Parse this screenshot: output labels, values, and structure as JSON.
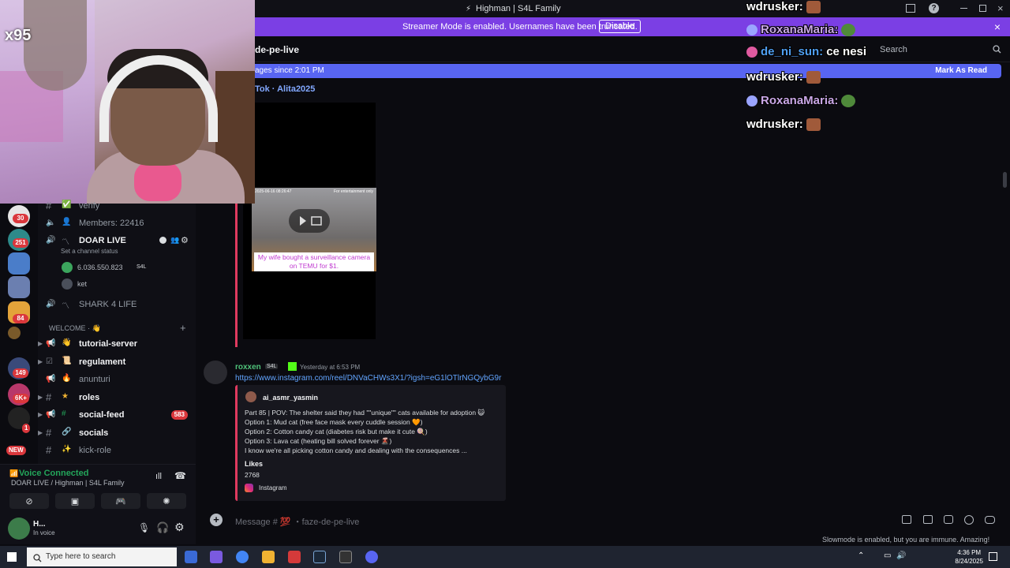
{
  "window": {
    "title": "Highman | S4L Family"
  },
  "banner": {
    "text": "Streamer Mode is enabled. Usernames have been truncated.",
    "disable_label": "Disable"
  },
  "header": {
    "channel": "de-pe-live",
    "search_placeholder": "Search"
  },
  "new_messages": {
    "text": "ages since 2:01 PM",
    "mark_read": "Mark As Read"
  },
  "webcam": {
    "overlay_text": "x95"
  },
  "rail": {
    "badges": [
      "30",
      "251",
      "84",
      "149",
      "6K+",
      "1",
      "NEW"
    ]
  },
  "sidebar": {
    "channels": [
      {
        "label": "verify"
      },
      {
        "label": "Members: 22416"
      },
      {
        "label": "DOAR LIVE",
        "status": "Set a channel status"
      },
      {
        "label": "6.036.550.823",
        "tag": "S4L"
      },
      {
        "label": "ket"
      },
      {
        "label": "SHARK 4 LIFE"
      },
      {
        "label": "WELCOME · 👋"
      },
      {
        "label": "tutorial-server"
      },
      {
        "label": "regulament"
      },
      {
        "label": "anunturi"
      },
      {
        "label": "roles"
      },
      {
        "label": "social-feed",
        "count": "583"
      },
      {
        "label": "socials"
      },
      {
        "label": "kick-role"
      }
    ]
  },
  "voice": {
    "status": "Voice Connected",
    "location": "DOAR LIVE / Highman | S4L Family"
  },
  "user": {
    "name": "H...",
    "status": "In voice"
  },
  "messages": {
    "tiktok_author": "Tok · Alita2025",
    "video_caption": "My wife bought a surveillance camera on TEMU for $1.",
    "video_timestamp": "2025-06-16 08:26:47",
    "video_watermark": "For entertainment only",
    "author": "roxxen",
    "author_tag": "S4L",
    "time": "Yesterday at 6:53 PM",
    "link": "https://www.instagram.com/reel/DNVaCHWs3X1/?igsh=eG1lOTlrNGQybG9r",
    "embed": {
      "author": "ai_asmr_yasmin",
      "lines": [
        "Part 85 | POV: The shelter said they had \"\"unique\"\" cats available for adoption 😺",
        "Option 1: Mud cat (free face mask every cuddle session 🧡)",
        "Option 2: Cotton candy cat (diabetes risk but make it cute 🍭)",
        "Option 3: Lava cat (heating bill solved forever 🌋)",
        "I know we're all picking cotton candy and dealing with the consequences ..."
      ],
      "likes_label": "Likes",
      "likes_value": "2768",
      "footer": "Instagram"
    }
  },
  "composer": {
    "placeholder": "Message # 💯 ・faze-de-pe-live"
  },
  "slowmode": "Slowmode is enabled, but you are immune. Amazing!",
  "chat_overlay": [
    {
      "user": "wdrusker:",
      "msg": ""
    },
    {
      "user": "RoxanaMaria:",
      "msg": ""
    },
    {
      "user": "de_ni_sun:",
      "msg": "ce nesi"
    },
    {
      "user": "wdrusker:",
      "msg": ""
    },
    {
      "user": "RoxanaMaria:",
      "msg": ""
    },
    {
      "user": "wdrusker:",
      "msg": ""
    }
  ],
  "taskbar": {
    "search_placeholder": "Type here to search",
    "time": "4:36 PM",
    "date": "8/24/2025"
  },
  "colors": {
    "accent": "#5865f2",
    "banner": "#7b3fe4",
    "online": "#23a55a",
    "mention": "#da373c"
  }
}
